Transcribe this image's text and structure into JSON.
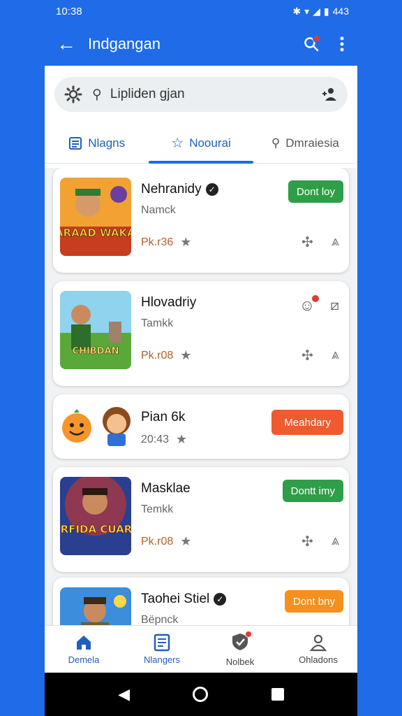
{
  "status": {
    "time": "10:38",
    "battery": "443"
  },
  "appbar": {
    "title": "Indgangan"
  },
  "search": {
    "text": "Lipliden gjan"
  },
  "tabs": [
    {
      "label": "Nlagns",
      "icon": "list-icon"
    },
    {
      "label": "Noourai",
      "icon": "star-outline-icon"
    },
    {
      "label": "Dmraiesia",
      "icon": "search-icon"
    }
  ],
  "cards": [
    {
      "title": "Nehranidy",
      "verified": true,
      "sub": "Namck",
      "price": "Pk.r36",
      "button": "Dont loy",
      "button_color": "#2e9e48",
      "thumb_text": "NEARAAD WAKAHA"
    },
    {
      "title": "Hlovadriy",
      "verified": false,
      "sub": "Tamkk",
      "price": "Pk.r08",
      "button": "",
      "thumb_text": "CHIBDAN"
    },
    {
      "title": "Pian 6k",
      "verified": false,
      "sub": "20:43",
      "price": "",
      "button": "Meahdary",
      "button_color": "#ef5a2f"
    },
    {
      "title": "Masklae",
      "verified": false,
      "sub": "Temkk",
      "price": "Pk.r08",
      "button": "Dontt imy",
      "button_color": "#2e9e48",
      "thumb_text": "FEIRFIDA CUARHA"
    },
    {
      "title": "Taohei Stiel",
      "verified": true,
      "sub": "Bёpnck",
      "price": "",
      "button": "Dont bny",
      "button_color": "#f5901f"
    }
  ],
  "bottomnav": [
    {
      "label": "Demela",
      "icon": "home-icon"
    },
    {
      "label": "Nlangers",
      "icon": "document-icon"
    },
    {
      "label": "Nolbek",
      "icon": "shield-check-icon"
    },
    {
      "label": "Ohladons",
      "icon": "person-icon"
    }
  ],
  "colors": {
    "primary": "#1f6be8",
    "green": "#2e9e48",
    "orange_red": "#ef5a2f",
    "orange": "#f5901f"
  }
}
